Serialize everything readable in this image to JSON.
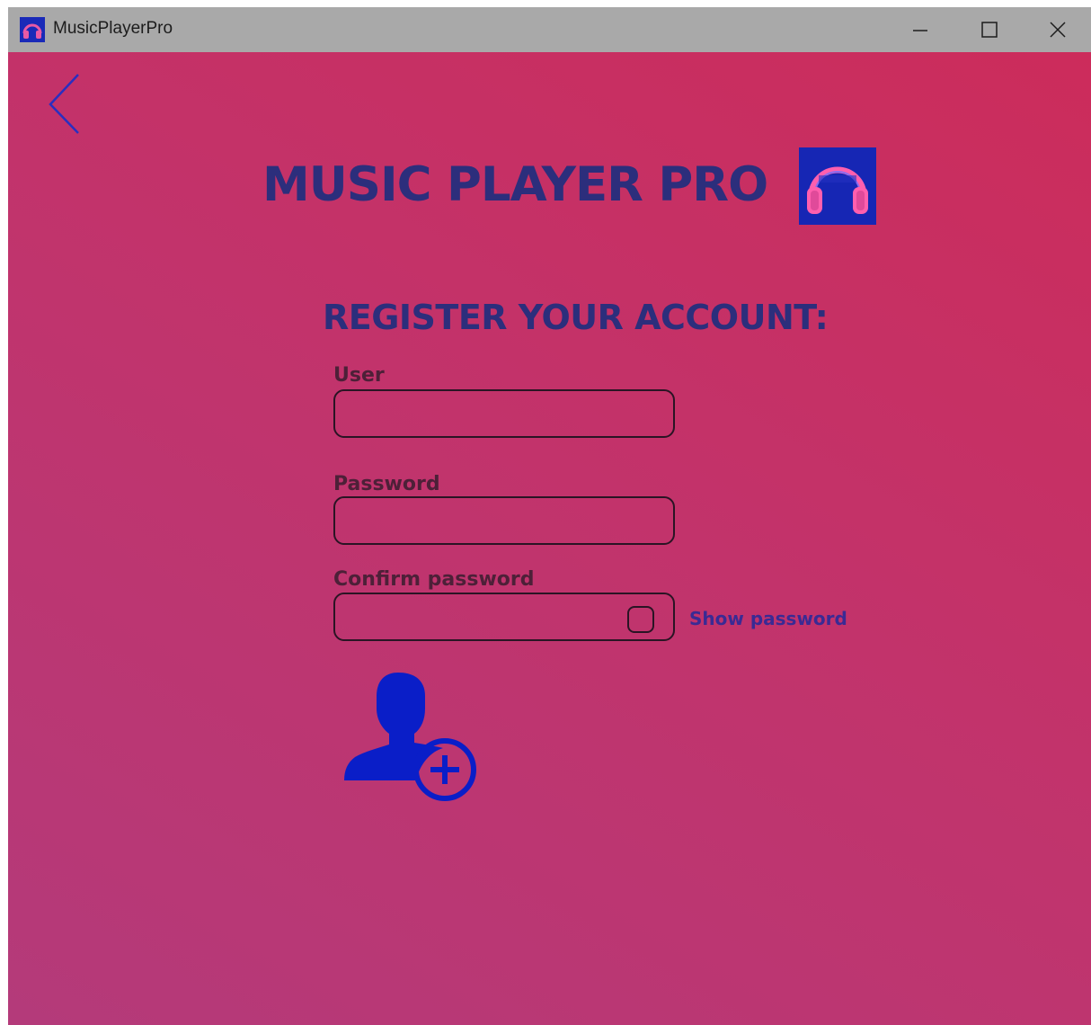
{
  "window": {
    "title": "MusicPlayerPro",
    "controls": [
      "minimize",
      "maximize",
      "close"
    ]
  },
  "header": {
    "title": "MUSIC PLAYER PRO",
    "logo_icon": "headphones-logo-icon"
  },
  "form": {
    "heading": "REGISTER YOUR ACCOUNT:",
    "user_label": "User",
    "user_value": "",
    "password_label": "Password",
    "password_value": "",
    "confirm_label": "Confirm password",
    "confirm_value": "",
    "show_password_label": "Show password",
    "show_password_checked": false,
    "submit_icon": "add-user-icon"
  },
  "colors": {
    "titlebar": "#a9a9a9",
    "background_start": "#b43a7a",
    "background_end": "#cc2c5b",
    "title_text": "#2c2e7c",
    "accent_blue": "#0a1ec8",
    "field_border": "#2a1424"
  }
}
